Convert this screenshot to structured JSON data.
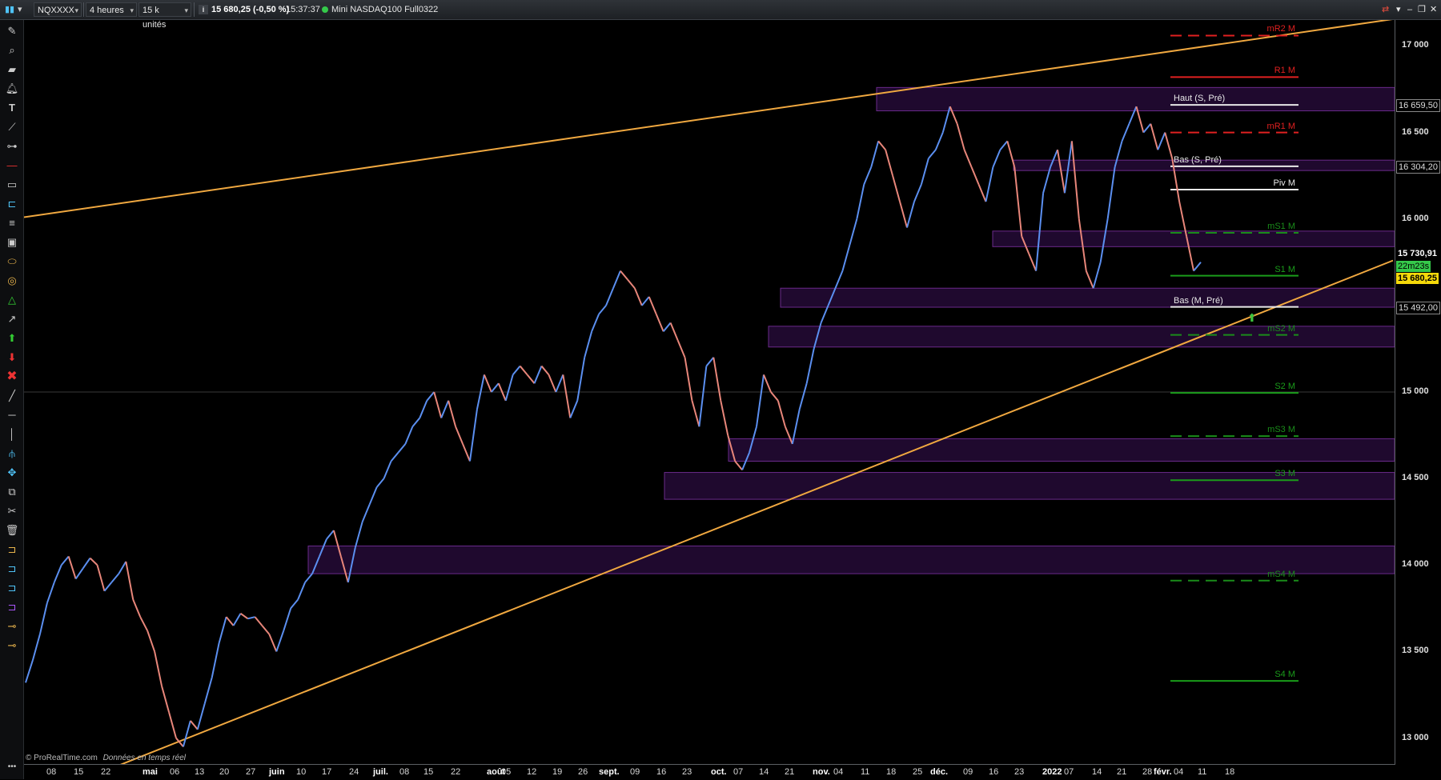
{
  "header": {
    "symbol": "NQXXXX",
    "period": "4 heures",
    "units": "15 k unités",
    "info_icon": "info-icon",
    "price_change": "15 680,25 (-0,50 %)",
    "time": "15:37:37",
    "status_color": "#35c94a",
    "instrument": "Mini NASDAQ100 Full0322"
  },
  "chart_data": {
    "type": "line",
    "x_ticks": [
      "08",
      "15",
      "22",
      "mai",
      "06",
      "13",
      "20",
      "27",
      "juin",
      "10",
      "17",
      "24",
      "juil.",
      "08",
      "15",
      "22",
      "août",
      "05",
      "12",
      "19",
      "26",
      "sept.",
      "09",
      "16",
      "23",
      "oct.",
      "07",
      "14",
      "21",
      "nov.",
      "04",
      "11",
      "18",
      "25",
      "déc.",
      "09",
      "16",
      "23",
      "2022",
      "07",
      "14",
      "21",
      "28",
      "févr.",
      "04",
      "11",
      "18"
    ],
    "y_ticks": [
      "17 000",
      "16 500",
      "16 000",
      "15 000",
      "14 500",
      "14 000",
      "13 500",
      "13 000"
    ],
    "ylim": [
      12850,
      17150
    ],
    "y_grid_highlight": 15000,
    "price_labels": {
      "high": "16 659,50",
      "low_week": "16 304,20",
      "last_close": "15 730,91",
      "countdown": "22m23s",
      "current": "15 680,25",
      "low_month": "15 492,00"
    },
    "pivots": [
      {
        "label": "mR2 M",
        "value": 17060,
        "color": "#e02020",
        "dashed": true
      },
      {
        "label": "R1 M",
        "value": 16820,
        "color": "#e02020",
        "dashed": false
      },
      {
        "label": "Haut (S, Pré)",
        "value": 16659.5,
        "color": "#e8e8e8",
        "dashed": false
      },
      {
        "label": "mR1 M",
        "value": 16500,
        "color": "#e02020",
        "dashed": true
      },
      {
        "label": "Bas (S, Pré)",
        "value": 16304.2,
        "color": "#e8e8e8",
        "dashed": false
      },
      {
        "label": "Piv M",
        "value": 16170,
        "color": "#e8e8e8",
        "dashed": false
      },
      {
        "label": "mS1 M",
        "value": 15920,
        "color": "#1a8c1a",
        "dashed": true
      },
      {
        "label": "S1 M",
        "value": 15672,
        "color": "#1a9c1a",
        "dashed": false
      },
      {
        "label": "Bas (M, Pré)",
        "value": 15492,
        "color": "#e8e8e8",
        "dashed": false
      },
      {
        "label": "mS2 M",
        "value": 15330,
        "color": "#1a8c1a",
        "dashed": true
      },
      {
        "label": "S2 M",
        "value": 14995,
        "color": "#1a9c1a",
        "dashed": false
      },
      {
        "label": "mS3 M",
        "value": 14745,
        "color": "#1a8c1a",
        "dashed": true
      },
      {
        "label": "S3 M",
        "value": 14490,
        "color": "#1a9c1a",
        "dashed": false
      },
      {
        "label": "mS4 M",
        "value": 13910,
        "color": "#1a8c1a",
        "dashed": true
      },
      {
        "label": "S4 M",
        "value": 13330,
        "color": "#1a9c1a",
        "dashed": false
      }
    ],
    "zones": [
      {
        "from": 16625,
        "to": 16760
      },
      {
        "from": 16280,
        "to": 16340
      },
      {
        "from": 15840,
        "to": 15930
      },
      {
        "from": 15490,
        "to": 15600
      },
      {
        "from": 15260,
        "to": 15380
      },
      {
        "from": 14600,
        "to": 14730
      },
      {
        "from": 14380,
        "to": 14535
      },
      {
        "from": 13950,
        "to": 14110
      }
    ],
    "channel": {
      "upper": [
        [
          0,
          16010
        ],
        [
          1710,
          17155
        ]
      ],
      "lower": [
        [
          0,
          12625
        ],
        [
          1710,
          15760
        ]
      ]
    },
    "price_series": [
      13320,
      13450,
      13600,
      13780,
      13900,
      14000,
      14050,
      13920,
      13980,
      14040,
      14000,
      13850,
      13900,
      13950,
      14020,
      13800,
      13700,
      13620,
      13500,
      13300,
      13150,
      13000,
      12950,
      13100,
      13050,
      13200,
      13350,
      13550,
      13700,
      13650,
      13720,
      13690,
      13700,
      13650,
      13600,
      13500,
      13620,
      13750,
      13800,
      13900,
      13950,
      14050,
      14150,
      14200,
      14050,
      13900,
      14100,
      14250,
      14350,
      14450,
      14500,
      14600,
      14650,
      14700,
      14800,
      14850,
      14950,
      15000,
      14850,
      14950,
      14800,
      14700,
      14600,
      14900,
      15100,
      15000,
      15050,
      14950,
      15100,
      15150,
      15100,
      15050,
      15150,
      15100,
      15000,
      15100,
      14850,
      14950,
      15200,
      15350,
      15450,
      15500,
      15600,
      15700,
      15650,
      15600,
      15500,
      15550,
      15450,
      15350,
      15400,
      15300,
      15200,
      14950,
      14800,
      15150,
      15200,
      14950,
      14750,
      14600,
      14550,
      14650,
      14800,
      15100,
      15000,
      14950,
      14800,
      14700,
      14900,
      15050,
      15250,
      15400,
      15500,
      15600,
      15700,
      15850,
      16000,
      16200,
      16300,
      16450,
      16400,
      16250,
      16100,
      15950,
      16100,
      16200,
      16350,
      16400,
      16500,
      16650,
      16550,
      16400,
      16300,
      16200,
      16100,
      16300,
      16400,
      16450,
      16300,
      15900,
      15800,
      15700,
      16150,
      16300,
      16400,
      16150,
      16450,
      16000,
      15700,
      15600,
      15750,
      16000,
      16300,
      16450,
      16550,
      16650,
      16500,
      16550,
      16400,
      16500,
      16350,
      16100,
      15900,
      15700,
      15750
    ]
  },
  "credit": "© ProRealTime.com",
  "credit_note": "Données en temps réel"
}
